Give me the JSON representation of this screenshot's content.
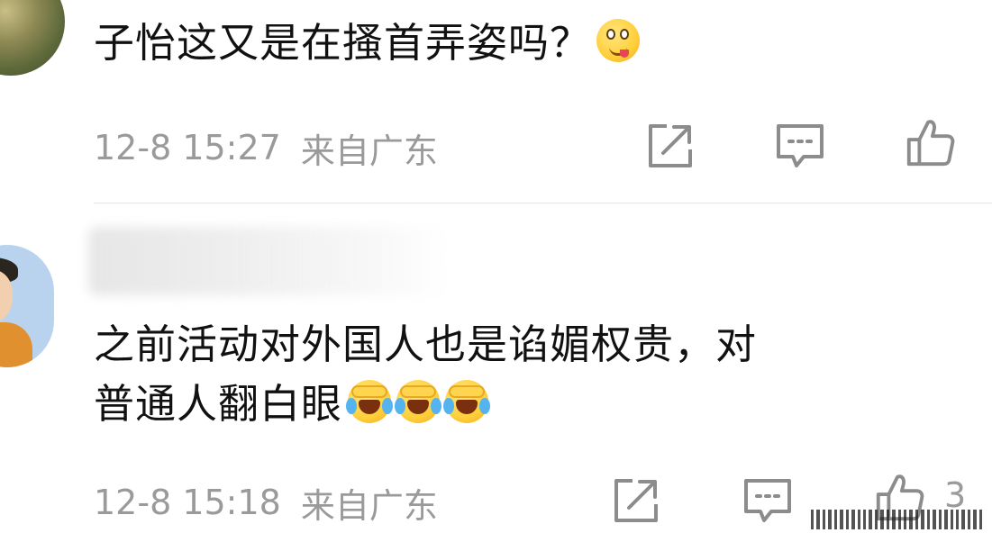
{
  "comments": [
    {
      "text": "子怡这又是在搔首弄姿吗？",
      "emoji": "tongue-out-emoji",
      "timestamp": "12-8 15:27",
      "location": "来自广东"
    },
    {
      "line1": "之前活动对外国人也是谄媚权贵，对",
      "line2": "普通人翻白眼",
      "emoji": "laugh-cry-emoji",
      "emoji_count": 3,
      "timestamp": "12-8 15:18",
      "location": "来自广东",
      "likes": "3"
    }
  ],
  "icons": {
    "share": "share-icon",
    "comment": "comment-icon",
    "like": "thumbs-up-icon"
  },
  "colors": {
    "text": "#111111",
    "meta": "#9a9a9a",
    "icon": "#8c8c8c",
    "divider": "#e6e6e6"
  }
}
